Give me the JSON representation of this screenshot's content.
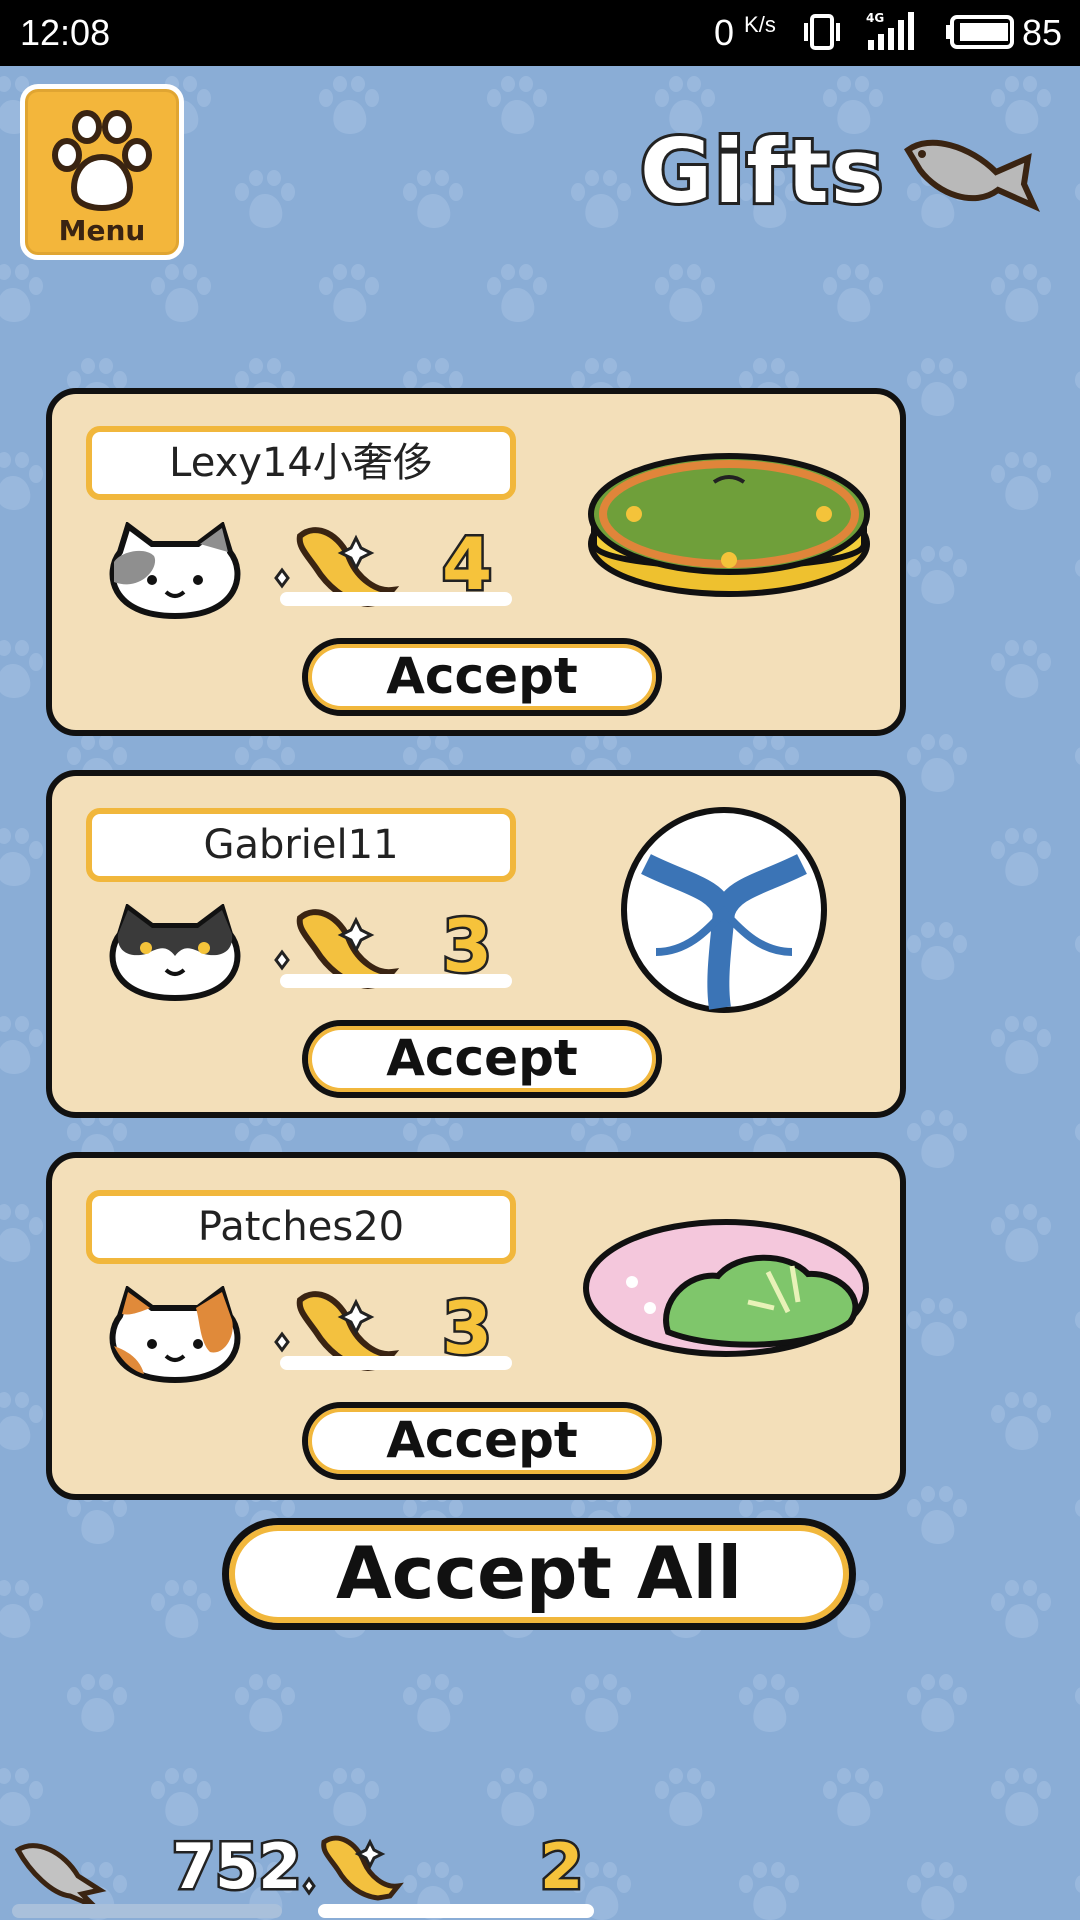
{
  "status_bar": {
    "time": "12:08",
    "net_speed_value": "0",
    "net_speed_unit": "K/s",
    "network_type": "4G",
    "battery_percent": "85"
  },
  "menu": {
    "label": "Menu",
    "icon": "paw-icon"
  },
  "header": {
    "title": "Gifts",
    "icon": "fish-icon"
  },
  "gifts": [
    {
      "sender": "Lexy14小奢侈",
      "cat": "calico-gray-cat",
      "reward_icon": "gold-fish-icon",
      "reward_count": "4",
      "accept_label": "Accept",
      "item": "gold-cushion"
    },
    {
      "sender": "Gabriel11",
      "cat": "black-white-cat",
      "reward_icon": "gold-fish-icon",
      "reward_count": "3",
      "accept_label": "Accept",
      "item": "ball"
    },
    {
      "sender": "Patches20",
      "cat": "calico-orange-cat",
      "reward_icon": "gold-fish-icon",
      "reward_count": "3",
      "accept_label": "Accept",
      "item": "food-bowl"
    }
  ],
  "accept_all_label": "Accept All",
  "bottom_bar": {
    "dried_fish_count": "752",
    "gold_fish_count": "2"
  },
  "colors": {
    "background": "#8aadd6",
    "card": "#f3dfb9",
    "accent": "#f1b73c",
    "gold": "#f6c33b"
  }
}
